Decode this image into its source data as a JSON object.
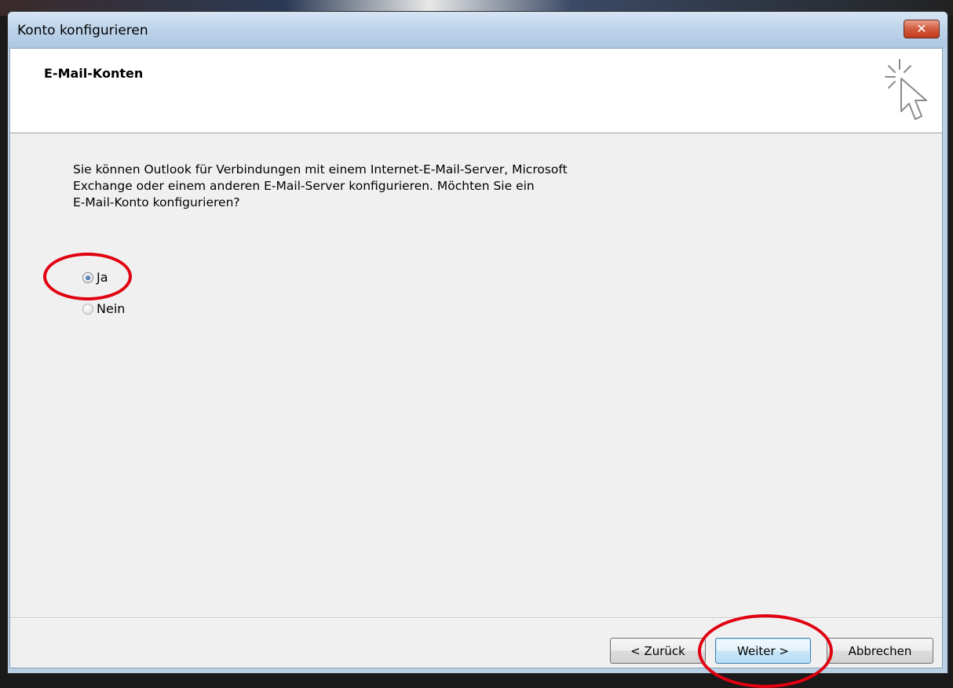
{
  "window": {
    "title": "Konto konfigurieren",
    "close_glyph": "✕"
  },
  "header": {
    "title": "E-Mail-Konten",
    "icon": "wizard-cursor-icon"
  },
  "body": {
    "lines": [
      "Sie können Outlook für Verbindungen mit einem Internet-E-Mail-Server, Microsoft",
      "Exchange oder einem anderen E-Mail-Server konfigurieren. Möchten Sie ein",
      "E-Mail-Konto konfigurieren?"
    ]
  },
  "options": [
    {
      "label": "Ja",
      "selected": true
    },
    {
      "label": "Nein",
      "selected": false
    }
  ],
  "buttons": {
    "back": "< Zurück",
    "next": "Weiter >",
    "cancel": "Abbrechen"
  },
  "colors": {
    "annotation": "#e00010",
    "titlebar": "#bdd3ea",
    "close_button": "#c23a1c"
  }
}
